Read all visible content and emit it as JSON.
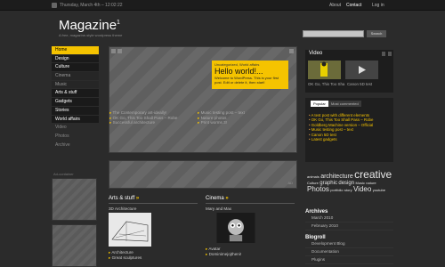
{
  "topbar": {
    "date": "Thursday, March 4th – 12:02:22",
    "nav": [
      "About",
      "Contact",
      "Log in"
    ],
    "rss_icon": "rss-icon"
  },
  "brand": {
    "title": "Magazine",
    "sup": "1",
    "tagline": "A free, magazine-style wordpress theme"
  },
  "search": {
    "placeholder": "",
    "button": "Search"
  },
  "nav": {
    "items": [
      "Home",
      "Design",
      "Culture",
      "Cinema",
      "Music",
      "Arts & stuff",
      "Gadgets",
      "Stories",
      "World affairs",
      "Video",
      "Photos",
      "Archive"
    ],
    "active": "Home"
  },
  "side_ad": {
    "title": "Ad-container"
  },
  "feature": {
    "category": "Uncategorized, World affairs",
    "title": "Hello world!...",
    "excerpt": "Welcome to WordPress. This is your first post. Edit or delete it, then start!",
    "accent": "#f5c300"
  },
  "links": {
    "left": [
      "The Contemporary art-ideally!",
      "OK Go, This Too Shall Pass – Robe",
      "Successful architecture"
    ],
    "right": [
      "Music testing post – text",
      "Nature photos",
      "Print worms 3!"
    ]
  },
  "strip": {
    "corner": "AD"
  },
  "sections": [
    {
      "head": "Arts & stuff",
      "sub": "3D Architecture",
      "items": [
        "Architecture",
        "Great sculptures"
      ]
    },
    {
      "head": "Cinema",
      "sub": "Mary and Max",
      "items": [
        "Avatar",
        "Dominimejojtheni!"
      ]
    }
  ],
  "video": {
    "title": "Video",
    "captions": [
      "OK Go, This Too Sha",
      "Canon 5D test"
    ]
  },
  "tabs": {
    "items": [
      "Popular",
      "Most commented"
    ],
    "list": [
      "A test post with different elements",
      "OK Go, This Too Shall Pass – Robe",
      "Goldberg Machine version – Official",
      "Music testing post – text",
      "Canon 5D test",
      "Latest gadgets"
    ]
  },
  "tags": [
    {
      "t": "animals",
      "s": 4
    },
    {
      "t": "architecture",
      "s": 7
    },
    {
      "t": "creative",
      "s": 12
    },
    {
      "t": "Culture",
      "s": 4
    },
    {
      "t": "graphic",
      "s": 6
    },
    {
      "t": "design",
      "s": 6
    },
    {
      "t": "Music",
      "s": 4
    },
    {
      "t": "nature",
      "s": 4
    },
    {
      "t": "Photos",
      "s": 8
    },
    {
      "t": "portfolio",
      "s": 4
    },
    {
      "t": "story",
      "s": 4
    },
    {
      "t": "Video",
      "s": 8
    },
    {
      "t": "youtube",
      "s": 4
    }
  ],
  "archives": {
    "title": "Archives",
    "items": [
      "March 2010",
      "February 2010"
    ]
  },
  "blogroll": {
    "title": "Blogroll",
    "items": [
      "Development Blog",
      "Documentation",
      "Plugins"
    ]
  }
}
